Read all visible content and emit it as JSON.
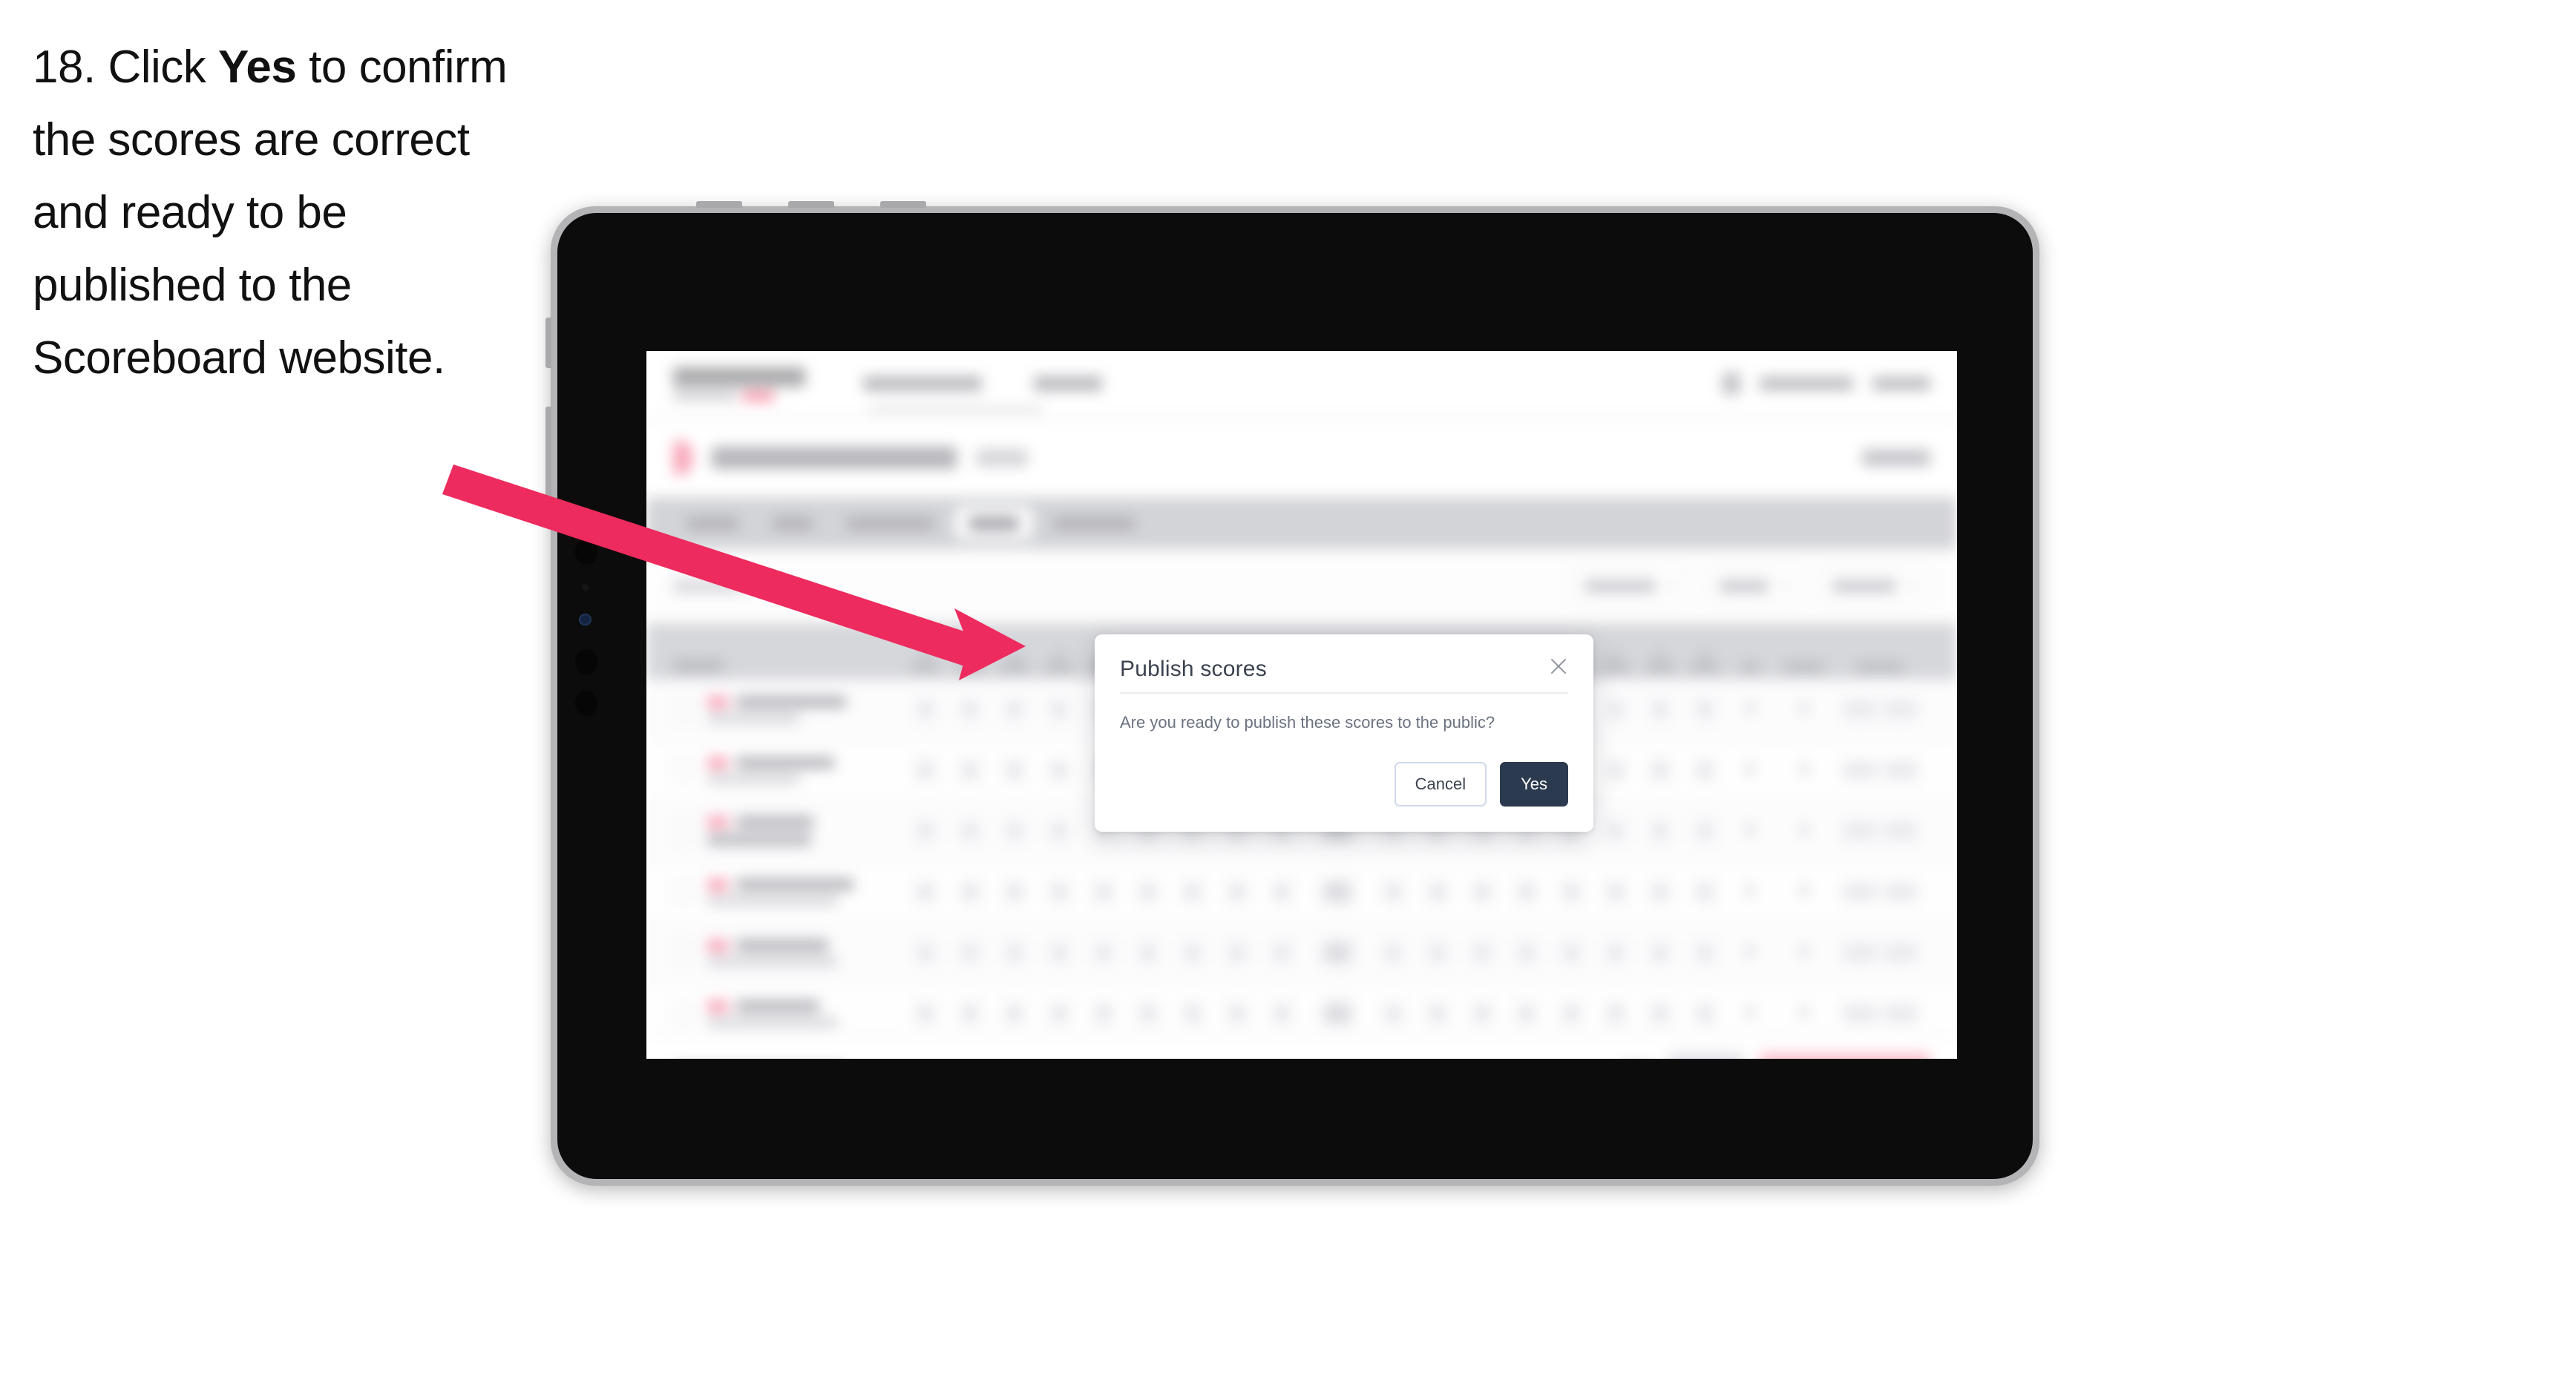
{
  "caption": {
    "number": "18.",
    "before": "Click",
    "emphasis": "Yes",
    "after": "to confirm the scores are correct and ready to be published to the Scoreboard website."
  },
  "modal": {
    "title": "Publish scores",
    "body": "Are you ready to publish these scores to the public?",
    "close_icon": "close-icon",
    "buttons": {
      "cancel": "Cancel",
      "yes": "Yes"
    }
  },
  "annotation": {
    "arrow_color": "#ED2B5E",
    "points_to": "Yes"
  },
  "colors": {
    "accent_pink": "#ED2B5E",
    "primary_dark": "#2B3A4E",
    "cancel_border": "#CFD9EC",
    "tab_strip": "#D3D4D8",
    "table_header": "#D6D7DB",
    "publish_button": "#FBC1CE",
    "tablet_bezel": "#B4B4B6",
    "tablet_screen_frame": "#0C0C0D"
  },
  "background_app": {
    "obscured": "blurred",
    "header": {
      "brand": "",
      "nav_items": [
        "",
        ""
      ],
      "right_items": [
        "",
        ""
      ]
    },
    "tabs": [
      {
        "label": "",
        "active": false
      },
      {
        "label": "",
        "active": false
      },
      {
        "label": "",
        "active": false
      },
      {
        "label": "",
        "active": true
      },
      {
        "label": "",
        "active": false
      }
    ],
    "filters": [
      "",
      "",
      ""
    ],
    "table": {
      "headers": [
        "",
        "",
        "",
        ""
      ],
      "row_count": 7
    },
    "footer": {
      "note": "",
      "cancel": "",
      "save": "",
      "publish": ""
    }
  }
}
